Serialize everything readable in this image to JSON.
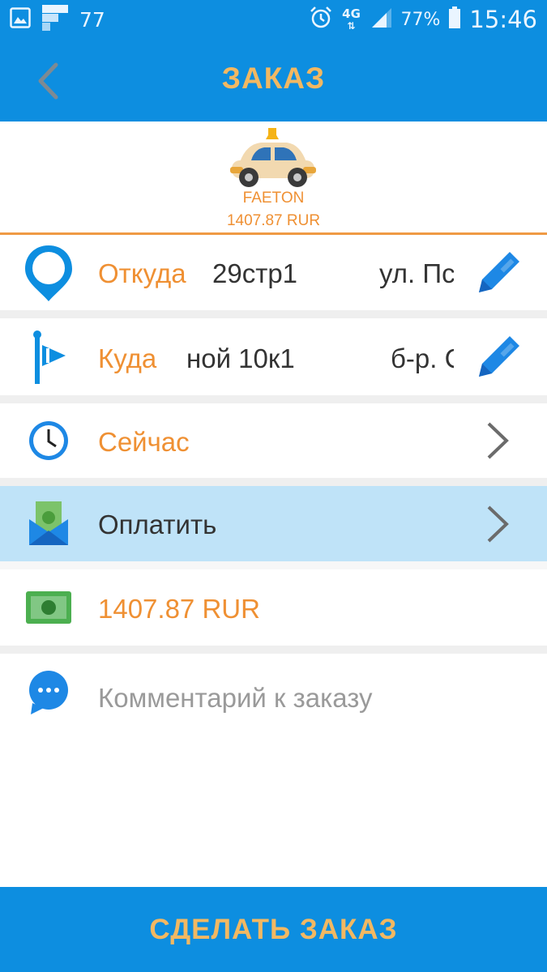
{
  "status_bar": {
    "notification_count": "77",
    "network": "4G",
    "battery": "77%",
    "time": "15:46",
    "icons": [
      "gallery-icon",
      "flipboard-icon",
      "alarm-icon",
      "network-4g-icon",
      "signal-icon",
      "battery-icon"
    ]
  },
  "header": {
    "title": "ЗАКАЗ",
    "back_icon": "chevron-left-icon"
  },
  "car": {
    "name": "FAETON",
    "price": "1407.87 RUR",
    "icon": "taxi-car-icon"
  },
  "rows": {
    "from": {
      "label": "Откуда",
      "address_left": "29стр1",
      "address_right": "ул. Пс",
      "icon": "location-pin-icon",
      "action_icon": "pencil-icon"
    },
    "to": {
      "label": "Куда",
      "address_left": "ной 10к1",
      "address_right": "б-р. С",
      "icon": "destination-flag-icon",
      "action_icon": "pencil-icon"
    },
    "time": {
      "label": "Сейчас",
      "icon": "clock-icon",
      "action_icon": "chevron-right-icon"
    },
    "payment": {
      "label": "Оплатить",
      "icon": "money-envelope-icon",
      "action_icon": "chevron-right-icon"
    },
    "cost": {
      "label": "1407.87 RUR",
      "icon": "cash-icon"
    },
    "comment": {
      "placeholder": "Комментарий к заказу",
      "icon": "chat-bubble-icon"
    }
  },
  "order_button": {
    "label": "СДЕЛАТЬ ЗАКАЗ"
  },
  "colors": {
    "primary_blue": "#0d8ee0",
    "accent_orange": "#ef9033",
    "header_text": "#f2b862",
    "payment_row_bg": "#bfe3f8",
    "separator": "#efefef"
  }
}
